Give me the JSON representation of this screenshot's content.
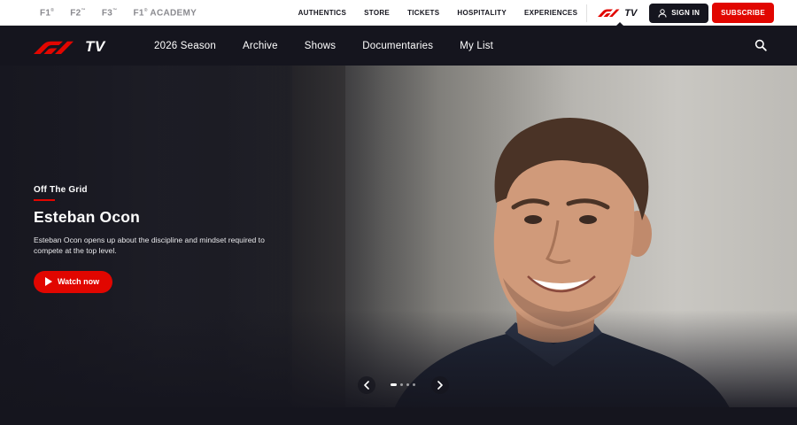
{
  "series": [
    {
      "label": "F1",
      "mark": "®"
    },
    {
      "label": "F2",
      "mark": "™"
    },
    {
      "label": "F3",
      "mark": "™"
    },
    {
      "label": "F1",
      "mark": "®",
      "suffix": " ACADEMY"
    }
  ],
  "utility_nav": {
    "links": [
      "AUTHENTICS",
      "STORE",
      "TICKETS",
      "HOSPITALITY",
      "EXPERIENCES"
    ],
    "tv_label": "TV",
    "sign_in": "SIGN IN",
    "subscribe": "SUBSCRIBE"
  },
  "main_nav": {
    "logo_text": "TV",
    "links": [
      "2026 Season",
      "Archive",
      "Shows",
      "Documentaries",
      "My List"
    ]
  },
  "hero": {
    "kicker": "Off The Grid",
    "title": "Esteban Ocon",
    "description": "Esteban Ocon opens up about the discipline and mindset required to compete at the top level.",
    "cta": "Watch now",
    "slides_total": 4,
    "active_slide": 1
  },
  "colors": {
    "brand_red": "#e10600",
    "dark": "#15151e",
    "muted_grey": "#8a8a8f"
  }
}
